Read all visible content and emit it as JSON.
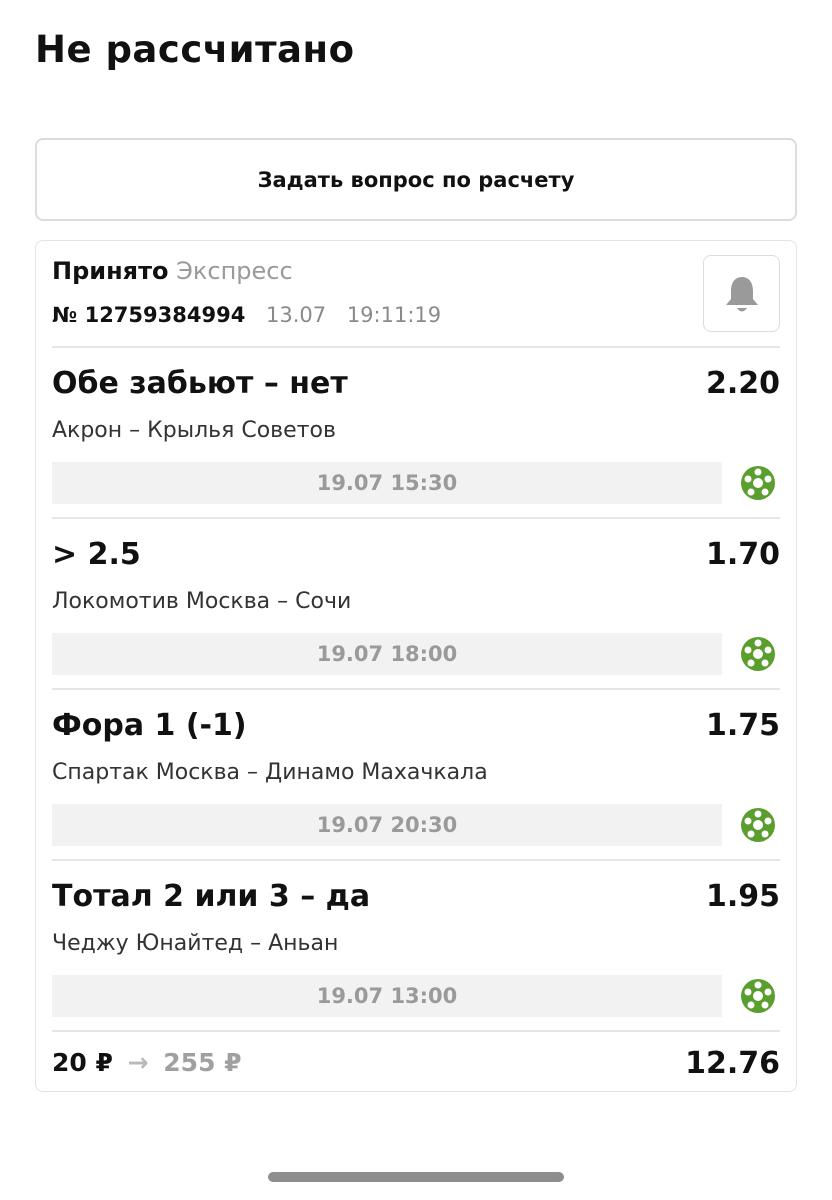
{
  "header": {
    "title": "Не рассчитано"
  },
  "actions": {
    "ask_button_label": "Задать вопрос по расчету"
  },
  "bet": {
    "status": "Принято",
    "type": "Экспресс",
    "number": "№ 12759384994",
    "date": "13.07",
    "time": "19:11:19",
    "bell_icon": "bell-icon",
    "events": [
      {
        "market": "Обе забьют – нет",
        "odds": "2.20",
        "teams": "Акрон – Крылья Советов",
        "start": "19.07 15:30",
        "sport_icon": "football-icon"
      },
      {
        "market": "> 2.5",
        "odds": "1.70",
        "teams": "Локомотив Москва – Сочи",
        "start": "19.07 18:00",
        "sport_icon": "football-icon"
      },
      {
        "market": "Фора 1 (-1)",
        "odds": "1.75",
        "teams": "Спартак Москва – Динамо Махачкала",
        "start": "19.07 20:30",
        "sport_icon": "football-icon"
      },
      {
        "market": "Тотал 2 или 3 – да",
        "odds": "1.95",
        "teams": "Чеджу Юнайтед – Аньан",
        "start": "19.07 13:00",
        "sport_icon": "football-icon"
      }
    ],
    "stake": "20 ₽",
    "arrow": "→",
    "potential_win": "255 ₽",
    "total_odds": "12.76"
  },
  "colors": {
    "accent_green": "#5a9e2e",
    "muted_text": "#9a9a9a",
    "date_bg": "#f2f2f2"
  }
}
